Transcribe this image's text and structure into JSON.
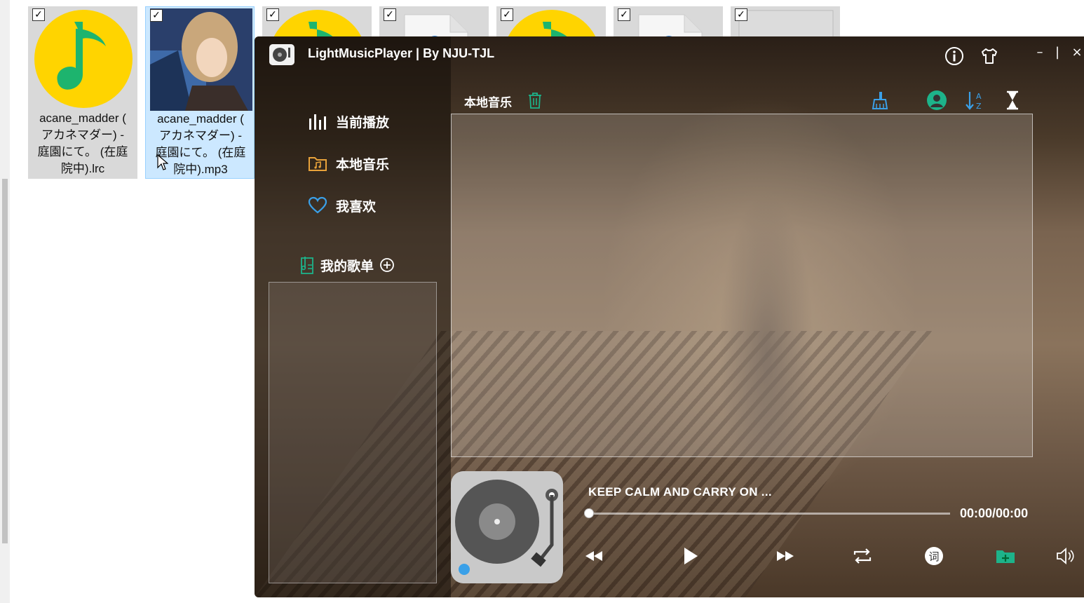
{
  "explorer": {
    "files": [
      {
        "label_lines": [
          "acane_madder (",
          "アカネマダー) -",
          "庭園にて。 (在庭",
          "院中).lrc"
        ],
        "icon": "qq-music-icon",
        "checked": true,
        "selected": false
      },
      {
        "label_lines": [
          "acane_madder (",
          "アカネマダー) -",
          "庭園にて。 (在庭",
          "院中).mp3"
        ],
        "icon": "album-art-thumbnail",
        "checked": true,
        "selected": true
      },
      {
        "icon": "qq-music-icon",
        "checked": true
      },
      {
        "icon": "generic-file-icon",
        "checked": true
      },
      {
        "icon": "qq-music-icon",
        "checked": true
      },
      {
        "icon": "generic-file-icon",
        "checked": true
      },
      {
        "icon": "blank-file-icon",
        "checked": true
      }
    ],
    "check_glyph": "☑"
  },
  "player": {
    "title": "LightMusicPlayer | By NJU-TJL",
    "window_buttons": {
      "minimize": "–",
      "maximize": "|",
      "close": "×"
    },
    "nav": [
      {
        "label": "当前播放",
        "icon": "equalizer-bars-icon"
      },
      {
        "label": "本地音乐",
        "icon": "music-folder-icon"
      },
      {
        "label": "我喜欢",
        "icon": "heart-icon"
      }
    ],
    "playlist_header": "我的歌单",
    "section_title": "本地音乐",
    "now_playing": {
      "title": "KEEP CALM AND CARRY ON ...",
      "time": "00:00/00:00",
      "progress": 0.0
    },
    "lyrics_label": "词",
    "colors": {
      "accent_green": "#1db38a",
      "accent_blue": "#3aa0e8",
      "folder_orange": "#e8a23a"
    }
  }
}
